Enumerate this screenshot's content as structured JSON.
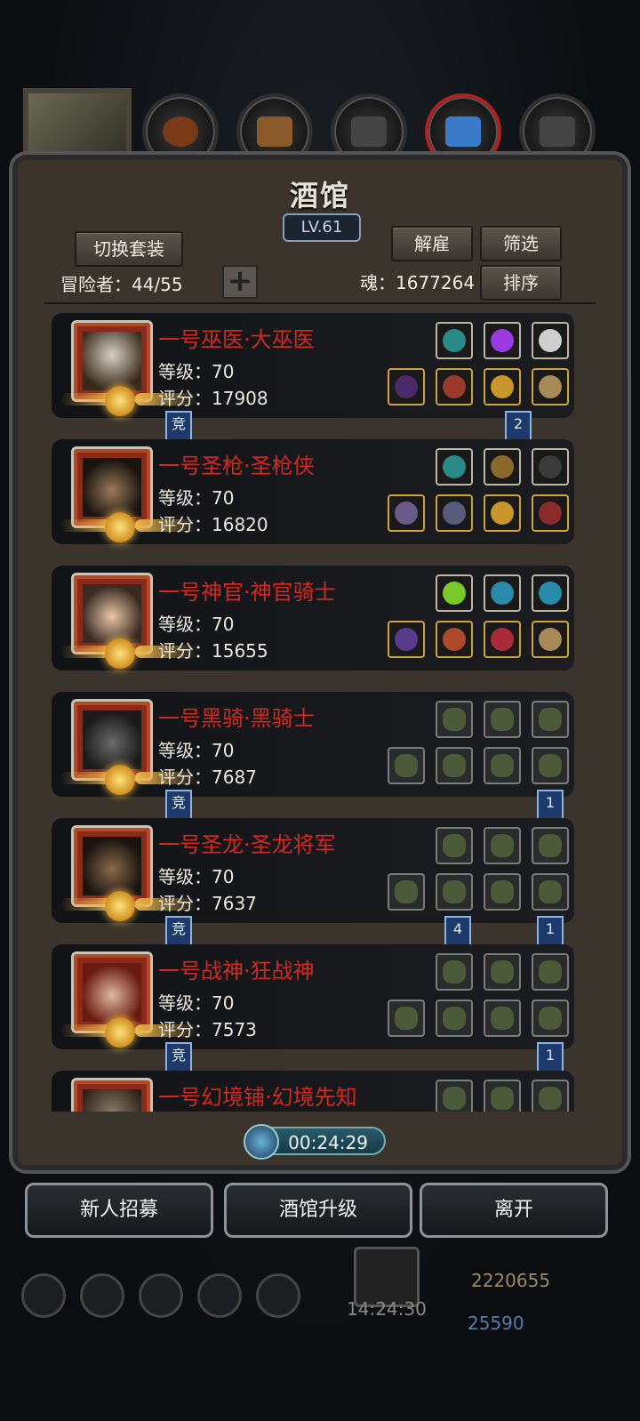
{
  "window": {
    "title": "酒馆",
    "level": "LV.61"
  },
  "buttons": {
    "switch_outfit": "切换套装",
    "dismiss": "解雇",
    "filter": "筛选",
    "sort": "排序",
    "add": "+"
  },
  "stats": {
    "adventurers_label": "冒险者：44/55",
    "soul_label": "魂：1677264"
  },
  "heroes": [
    {
      "name": "一号巫医·大巫医",
      "level": "等级：70",
      "score": "评分：17908",
      "left_tag": "竞",
      "right_tag": "2"
    },
    {
      "name": "一号圣枪·圣枪侠",
      "level": "等级：70",
      "score": "评分：16820"
    },
    {
      "name": "一号神官·神官骑士",
      "level": "等级：70",
      "score": "评分：15655"
    },
    {
      "name": "一号黑骑·黑骑士",
      "level": "等级：70",
      "score": "评分：7687",
      "left_tag": "竞",
      "right_tag": "1"
    },
    {
      "name": "一号圣龙·圣龙将军",
      "level": "等级：70",
      "score": "评分：7637",
      "left_tag": "竞",
      "mid_tag": "4",
      "right_tag": "1"
    },
    {
      "name": "一号战神·狂战神",
      "level": "等级：70",
      "score": "评分：7573",
      "left_tag": "竞",
      "right_tag": "1"
    },
    {
      "name": "一号幻境铺·幻境先知"
    }
  ],
  "timer": "00:24:29",
  "actions": {
    "recruit": "新人招募",
    "upgrade": "酒馆升级",
    "leave": "离开"
  },
  "footer": {
    "gold": "2220655",
    "gems": "25590",
    "clock": "14:24:30"
  },
  "colors": {
    "name_red": "#d12a22",
    "panel": "#3b342c",
    "tag_blue": "#1e3a6a"
  }
}
